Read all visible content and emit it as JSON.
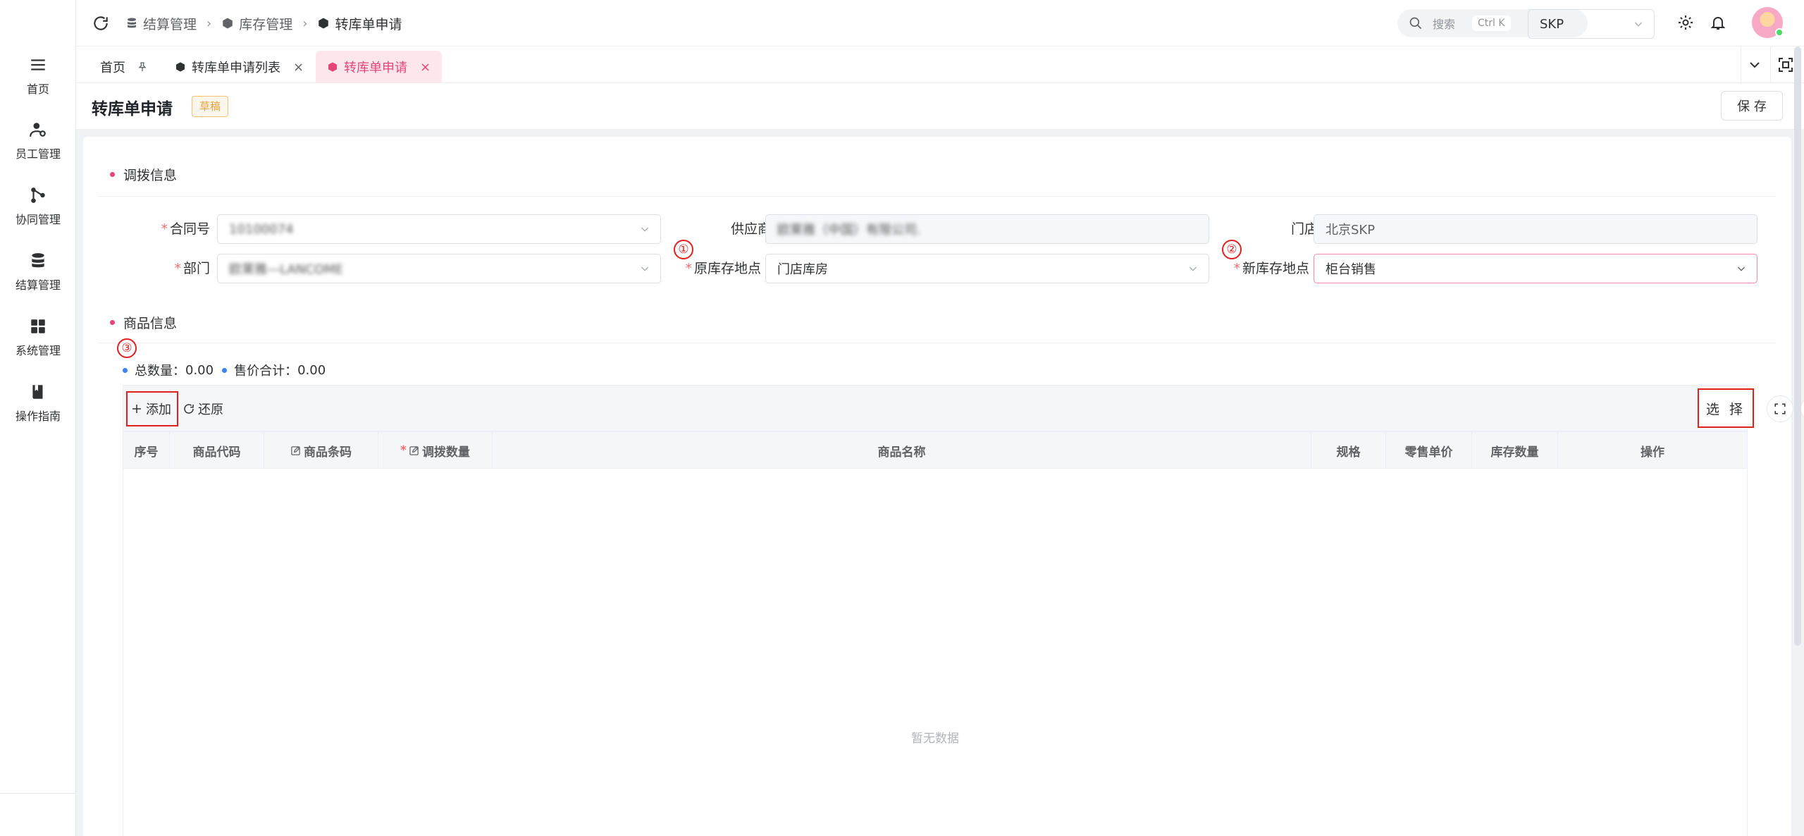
{
  "sidebar": {
    "items": [
      {
        "label": "首页",
        "icon": "menu-icon"
      },
      {
        "label": "员工管理",
        "icon": "user-gear-icon"
      },
      {
        "label": "协同管理",
        "icon": "branch-icon"
      },
      {
        "label": "结算管理",
        "icon": "database-icon"
      },
      {
        "label": "系统管理",
        "icon": "grid-icon"
      },
      {
        "label": "操作指南",
        "icon": "book-icon"
      }
    ]
  },
  "header": {
    "breadcrumb": [
      "结算管理",
      "库存管理",
      "转库单申请"
    ],
    "search_placeholder": "搜索",
    "search_shortcut": "Ctrl K",
    "store": "SKP"
  },
  "tabs": [
    {
      "label": "首页",
      "pinned": true
    },
    {
      "label": "转库单申请列表",
      "closable": true
    },
    {
      "label": "转库单申请",
      "closable": true,
      "active": true
    }
  ],
  "page": {
    "title": "转库单申请",
    "status": "草稿",
    "save_label": "保 存"
  },
  "allocation": {
    "section_title": "调拨信息",
    "contract_label": "合同号",
    "contract_value": "10100074",
    "supplier_label": "供应商",
    "supplier_value": "欧莱雅（中国）有限公司.",
    "store_label": "门店",
    "store_value": "北京SKP",
    "dept_label": "部门",
    "dept_value": "欧莱雅—LANCOME",
    "orig_loc_label": "原库存地点",
    "orig_loc_value": "门店库房",
    "new_loc_label": "新库存地点",
    "new_loc_value": "柜台销售"
  },
  "annotations": [
    "①",
    "②",
    "③"
  ],
  "goods": {
    "section_title": "商品信息",
    "total_qty_label": "总数量：",
    "total_qty": "0.00",
    "total_price_label": "售价合计：",
    "total_price": "0.00",
    "add_label": "添加",
    "restore_label": "还原",
    "select_label": "选 择",
    "columns": [
      "序号",
      "商品代码",
      "商品条码",
      "调拨数量",
      "商品名称",
      "规格",
      "零售单价",
      "库存数量",
      "操作"
    ],
    "empty_text": "暂无数据"
  },
  "colors": {
    "accent": "#e6457a",
    "annotation": "#e02020",
    "draft": "#e6a23c"
  }
}
